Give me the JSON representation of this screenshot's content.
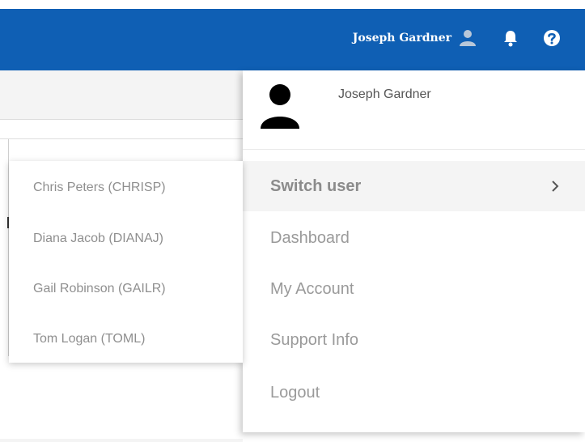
{
  "header": {
    "user_name": "Joseph Gardner",
    "icons": [
      "user-icon",
      "bell-icon",
      "help-icon"
    ],
    "bar_color": "#0f5fb4"
  },
  "account_menu": {
    "user_name": "Joseph Gardner",
    "items": [
      {
        "label": "Switch user",
        "active": true,
        "has_submenu": true
      },
      {
        "label": "Dashboard"
      },
      {
        "label": "My Account"
      },
      {
        "label": "Support Info"
      },
      {
        "label": "Logout"
      }
    ]
  },
  "switch_user_submenu": {
    "users": [
      {
        "label": "Chris Peters (CHRISP)"
      },
      {
        "label": "Diana Jacob (DIANAJ)"
      },
      {
        "label": "Gail Robinson (GAILR)"
      },
      {
        "label": "Tom Logan (TOML)"
      }
    ]
  }
}
